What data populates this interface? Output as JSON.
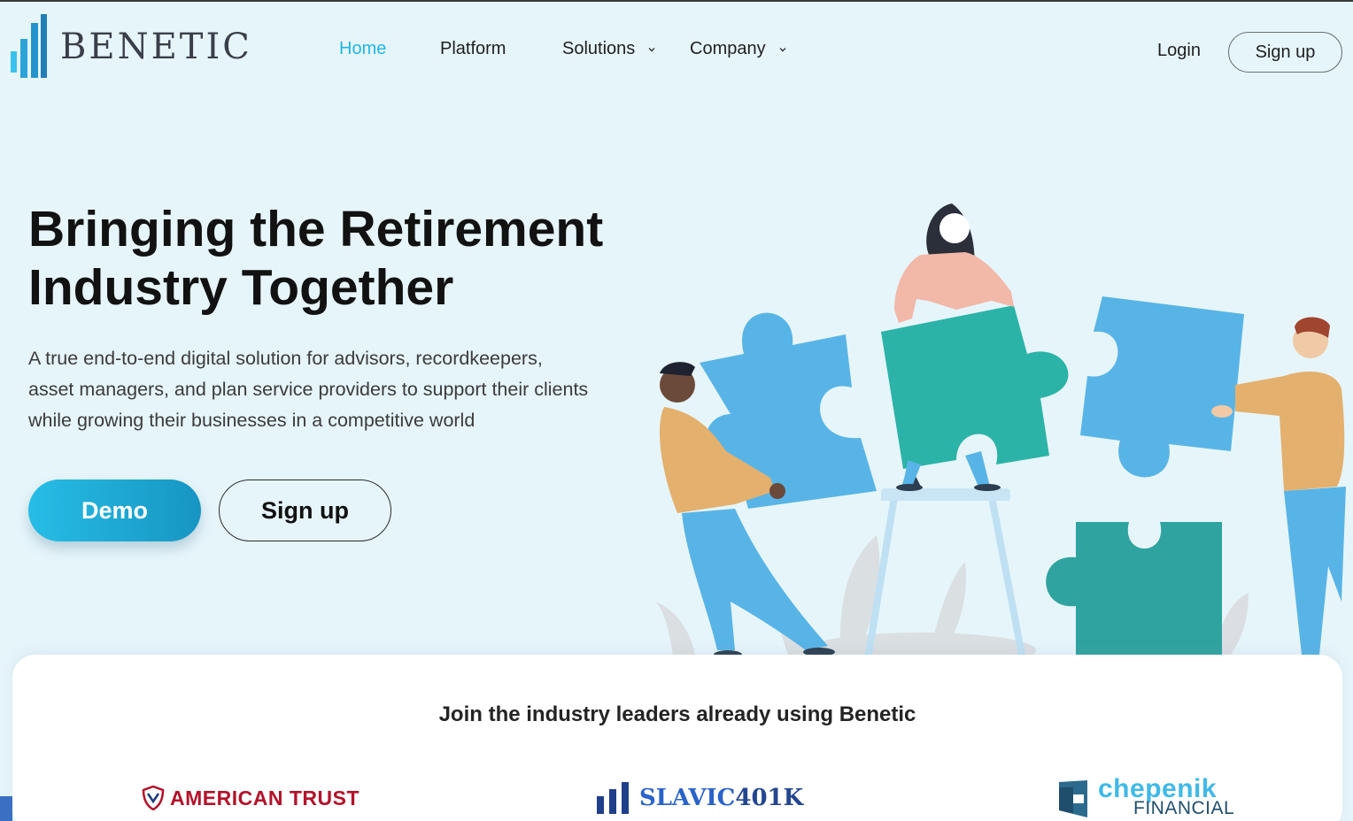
{
  "brand": {
    "name": "BENETIC",
    "colors": {
      "accent": "#22b5e6",
      "logo_bar_light": "#39c2ec",
      "logo_bar_dark": "#1f7fb6"
    }
  },
  "nav": {
    "items": [
      {
        "label": "Home",
        "active": true,
        "has_dropdown": false
      },
      {
        "label": "Platform",
        "active": false,
        "has_dropdown": false
      },
      {
        "label": "Solutions",
        "active": false,
        "has_dropdown": true
      },
      {
        "label": "Company",
        "active": false,
        "has_dropdown": true
      }
    ],
    "login_label": "Login",
    "signup_label": "Sign up"
  },
  "hero": {
    "title_line1": "Bringing the Retirement",
    "title_line2": "Industry Together",
    "subtitle_line1": "A true end-to-end digital solution for advisors, recordkeepers,",
    "subtitle_line2": "asset managers, and plan service providers to support their clients",
    "subtitle_line3": "while growing their businesses in a competitive world",
    "demo_label": "Demo",
    "signup_label": "Sign up",
    "illustration": "team-assembling-puzzle-illustration"
  },
  "partners": {
    "heading": "Join the industry leaders already using Benetic",
    "items": [
      {
        "name": "AMERICAN TRUST",
        "icon": "shield-logo-icon",
        "color": "#b3122a"
      },
      {
        "name": "SLAVIC",
        "number": "401K",
        "icon": "bars-logo-icon",
        "color": "#2a63c9"
      },
      {
        "name": "chepenik",
        "subname": "FINANCIAL",
        "icon": "door-logo-icon",
        "color": "#41b9e6"
      }
    ]
  }
}
